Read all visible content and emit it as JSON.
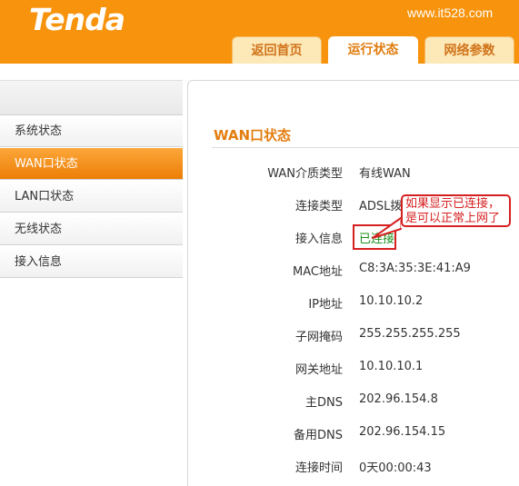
{
  "header": {
    "logo": "Tenda",
    "url": "www.it528.com",
    "tabs": [
      {
        "label": "返回首页"
      },
      {
        "label": "运行状态"
      },
      {
        "label": "网络参数"
      }
    ]
  },
  "sidebar": {
    "items": [
      {
        "label": "系统状态"
      },
      {
        "label": "WAN口状态"
      },
      {
        "label": "LAN口状态"
      },
      {
        "label": "无线状态"
      },
      {
        "label": "接入信息"
      }
    ]
  },
  "main": {
    "title": "WAN口状态",
    "rows": [
      {
        "label": "WAN介质类型",
        "value": "有线WAN"
      },
      {
        "label": "连接类型",
        "value": "ADSL拨号"
      },
      {
        "label": "接入信息",
        "value": "已连接"
      },
      {
        "label": "MAC地址",
        "value": "C8:3A:35:3E:41:A9"
      },
      {
        "label": "IP地址",
        "value": "10.10.10.2"
      },
      {
        "label": "子网掩码",
        "value": "255.255.255.255"
      },
      {
        "label": "网关地址",
        "value": "10.10.10.1"
      },
      {
        "label": "主DNS",
        "value": "202.96.154.8"
      },
      {
        "label": "备用DNS",
        "value": "202.96.154.15"
      },
      {
        "label": "连接时间",
        "value": "0天00:00:43"
      }
    ]
  },
  "annotation": {
    "line1": "如果显示已连接，",
    "line2": "是可以正常上网了"
  },
  "colors": {
    "brand_orange": "#f7930c",
    "connected_green": "#1a8f1a",
    "annotation_red": "#d62020"
  }
}
